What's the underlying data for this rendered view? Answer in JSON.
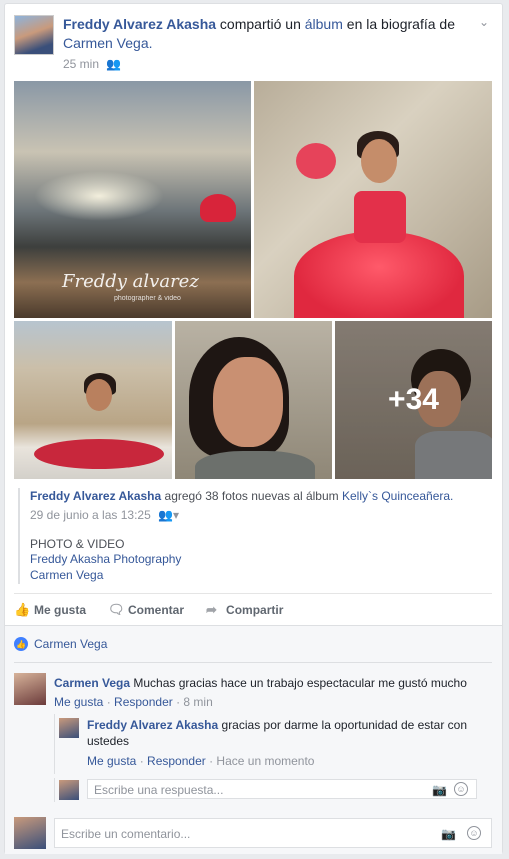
{
  "post": {
    "author": "Freddy Alvarez Akasha",
    "action_text": "compartió un",
    "album_word": "álbum",
    "in_text": "en la biografía de",
    "target": "Carmen Vega.",
    "time": "25 min",
    "privacy_icon": "friends-icon",
    "options_icon": "chevron-down-icon"
  },
  "photos": {
    "signature": "Freddy alvarez",
    "signature_sub": "photographer & video",
    "more_count": "+34"
  },
  "album": {
    "author": "Freddy Alvarez Akasha",
    "added_text": "agregó 38 fotos nuevas al álbum",
    "album_name": "Kelly`s Quinceañera.",
    "date": "29 de junio a las 13:25",
    "category": "PHOTO & VIDEO",
    "links": [
      "Freddy Akasha Photography",
      "Carmen Vega"
    ]
  },
  "actions": {
    "like": "Me gusta",
    "comment": "Comentar",
    "share": "Compartir"
  },
  "likes": {
    "names": "Carmen Vega"
  },
  "comments": [
    {
      "author": "Carmen Vega",
      "text": "Muchas gracias hace un trabajo espectacular me gustó mucho",
      "like": "Me gusta",
      "reply": "Responder",
      "time": "8 min"
    },
    {
      "author": "Freddy Alvarez Akasha",
      "text": "gracias por darme la oportunidad de estar con ustedes",
      "like": "Me gusta",
      "reply": "Responder",
      "time": "Hace un momento"
    }
  ],
  "reply_input": {
    "placeholder": "Escribe una respuesta..."
  },
  "comment_input": {
    "placeholder": "Escribe un comentario..."
  },
  "colors": {
    "link": "#365899",
    "like_badge": "#4080ff",
    "background": "#e9ebee"
  }
}
